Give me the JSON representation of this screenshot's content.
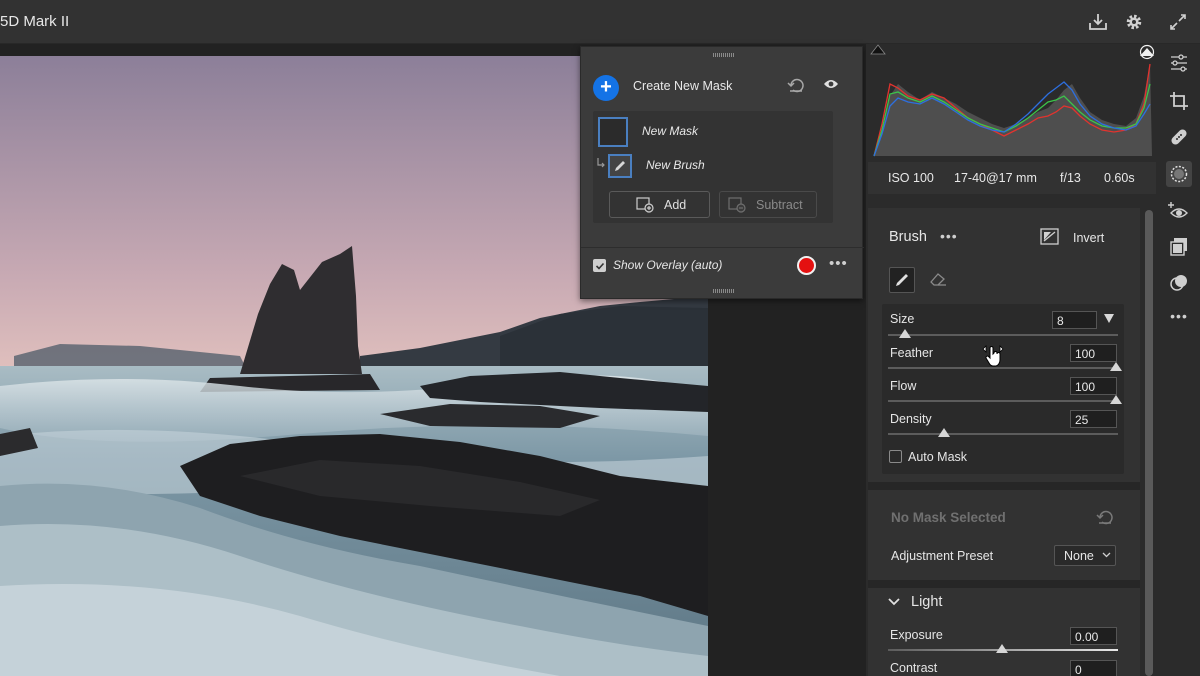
{
  "window": {
    "title": "5D Mark II"
  },
  "top_icons": [
    "download-icon",
    "gear-icon",
    "expand-icon"
  ],
  "mask_panel": {
    "create_label": "Create New Mask",
    "masks": [
      {
        "name": "New Mask"
      },
      {
        "name": "New Brush"
      }
    ],
    "add_label": "Add",
    "subtract_label": "Subtract",
    "overlay_label": "Show Overlay (auto)",
    "overlay_checked": true,
    "overlay_color": "#e41010"
  },
  "exif": {
    "iso": "ISO 100",
    "lens": "17-40@17 mm",
    "aperture": "f/13",
    "shutter": "0.60s"
  },
  "brush": {
    "title": "Brush",
    "invert_label": "Invert",
    "sliders": [
      {
        "label": "Size",
        "value": "8"
      },
      {
        "label": "Feather",
        "value": "100"
      },
      {
        "label": "Flow",
        "value": "100"
      },
      {
        "label": "Density",
        "value": "25"
      }
    ],
    "auto_mask_label": "Auto Mask",
    "auto_mask_checked": false
  },
  "mask_section": {
    "title": "No Mask Selected",
    "preset_label": "Adjustment Preset",
    "preset_value": "None"
  },
  "light": {
    "title": "Light",
    "sliders": [
      {
        "label": "Exposure",
        "value": "0.00"
      },
      {
        "label": "Contrast",
        "value": "0"
      }
    ]
  },
  "colors": {
    "accent": "#1473e6",
    "panel": "#323232",
    "background": "#1d1d1d"
  }
}
